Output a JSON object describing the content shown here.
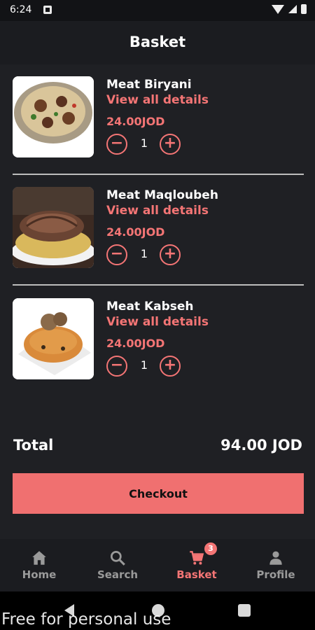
{
  "status": {
    "time": "6:24"
  },
  "header": {
    "title": "Basket"
  },
  "items": [
    {
      "name": "Meat Biryani",
      "details": "View all details",
      "price": "24.00JOD",
      "qty": "1",
      "minus": "−",
      "plus": "+"
    },
    {
      "name": "Meat Maqloubeh",
      "details": "View all details",
      "price": "24.00JOD",
      "qty": "1",
      "minus": "−",
      "plus": "+"
    },
    {
      "name": "Meat Kabseh",
      "details": "View all details",
      "price": "24.00JOD",
      "qty": "1",
      "minus": "−",
      "plus": "+"
    }
  ],
  "summary": {
    "total_label": "Total",
    "total_value": "94.00 JOD"
  },
  "checkout": {
    "label": "Checkout"
  },
  "nav": {
    "items": [
      {
        "label": "Home",
        "icon": "home-icon"
      },
      {
        "label": "Search",
        "icon": "search-icon"
      },
      {
        "label": "Basket",
        "icon": "cart-icon",
        "badge": "3"
      },
      {
        "label": "Profile",
        "icon": "person-icon"
      }
    ]
  },
  "watermark": "Free for personal use",
  "colors": {
    "accent": "#f47575",
    "background": "#1f2024",
    "checkout": "#f07070"
  }
}
